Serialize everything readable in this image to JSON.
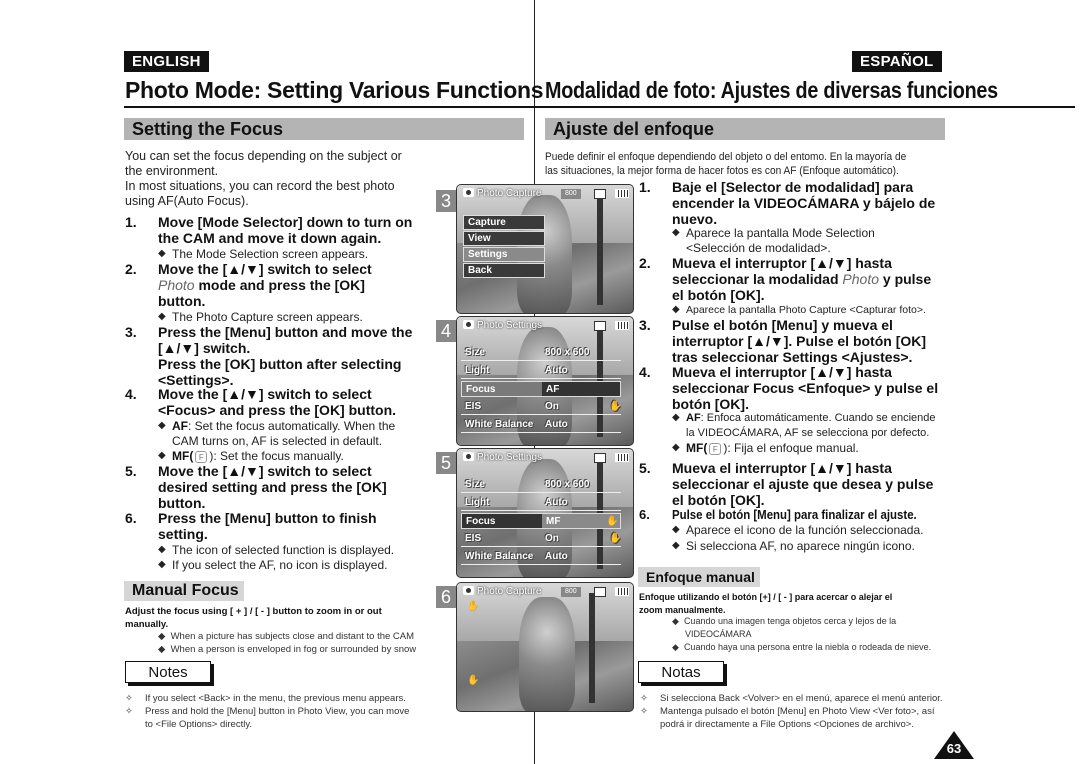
{
  "english": {
    "lang_label": "ENGLISH",
    "page_title": "Photo Mode: Setting Various Functions",
    "section_title": "Setting the Focus",
    "intro": [
      "You can set the focus depending on the subject or",
      "the environment.",
      "In most situations, you can record the best photo",
      "using AF(Auto Focus)."
    ],
    "steps": [
      {
        "num": "1.",
        "lines": [
          "Move [Mode Selector] down to turn on",
          "the CAM and move it down again."
        ]
      },
      {
        "num": "2.",
        "lines": [
          "Move the [▲/▼] switch to select",
          "mode and press the [OK]",
          "button."
        ],
        "italic_word": "Photo"
      },
      {
        "num": "3.",
        "lines": [
          "Press the [Menu] button and move the",
          "[▲/▼] switch.",
          "Press the [OK] button after selecting",
          "<Settings>."
        ]
      },
      {
        "num": "4.",
        "lines": [
          "Move the [▲/▼] switch to select",
          "<Focus> and press the [OK] button."
        ]
      },
      {
        "num": "5.",
        "lines": [
          "Move the [▲/▼] switch to select",
          "desired setting and press the [OK]",
          "button."
        ]
      },
      {
        "num": "6.",
        "lines": [
          "Press the [Menu] button to finish",
          "setting."
        ]
      }
    ],
    "bullets": {
      "step1": "The Mode Selection screen appears.",
      "step2": "The Photo Capture screen appears.",
      "step4_af_label": "AF",
      "step4_af_text": ": Set the focus automatically. When the",
      "step4_af_text2": "CAM turns on, AF is selected in default.",
      "step4_mf_label": "MF(",
      "step4_mf_text": "): Set the focus manually.",
      "step6_a": "The icon of selected function is displayed.",
      "step6_b": "If you select the AF, no icon is displayed."
    },
    "manual_focus": {
      "title": "Manual Focus",
      "desc_line1": "Adjust the focus using [ + ] / [ - ] button to zoom in or out",
      "desc_line2": "manually.",
      "bullets": [
        "When a picture has subjects close and distant to   the CAM",
        "When a person is enveloped in fog or surrounded by snow"
      ]
    },
    "notes": {
      "title": "Notes",
      "items": [
        "If you select <Back> in the menu, the previous menu appears.",
        "Press and hold the [Menu] button in Photo View, you can move",
        "to <File Options> directly."
      ]
    }
  },
  "spanish": {
    "lang_label": "ESPAÑOL",
    "page_title": "Modalidad de foto: Ajustes de diversas funciones",
    "section_title": "Ajuste del enfoque",
    "intro": [
      "Puede definir el enfoque dependiendo del objeto o del entomo. En la mayoría de",
      "las situaciones, la mejor forma de hacer fotos es con AF (Enfoque automático)."
    ],
    "steps": [
      {
        "num": "1.",
        "lines": [
          "Baje el [Selector de modalidad] para",
          "encender la VIDEOCÁMARA y bájelo de",
          "nuevo."
        ]
      },
      {
        "num": "2.",
        "lines": [
          "Mueva el interruptor [▲/▼] hasta",
          "seleccionar la modalidad",
          "y pulse",
          "el botón [OK]."
        ],
        "italic_word": "Photo"
      },
      {
        "num": "3.",
        "lines": [
          "Pulse el botón [Menu] y mueva el",
          "interruptor [▲/▼]. Pulse el botón [OK]",
          "tras seleccionar Settings <Ajustes>."
        ]
      },
      {
        "num": "4.",
        "lines": [
          "Mueva el interruptor [▲/▼] hasta",
          "seleccionar Focus <Enfoque> y pulse el",
          "botón [OK]."
        ]
      },
      {
        "num": "5.",
        "lines": [
          "Mueva el interruptor [▲/▼] hasta",
          "seleccionar el ajuste que desea y pulse",
          "el botón [OK]."
        ]
      },
      {
        "num": "6.",
        "lines": [
          "Pulse el botón [Menu] para finalizar el ajuste."
        ]
      }
    ],
    "bullets": {
      "step1_a": "Aparece la pantalla Mode Selection",
      "step1_b": "<Selección de modalidad>.",
      "step2": "Aparece la pantalla Photo Capture <Capturar foto>.",
      "step4_af_label": "AF",
      "step4_af_text": ": Enfoca automáticamente. Cuando se enciende",
      "step4_af_text2": "la VIDEOCÁMARA, AF se selecciona por defecto.",
      "step4_mf_label": "MF(",
      "step4_mf_text": "): Fija el enfoque manual.",
      "step6_a": "Aparece el icono de la función seleccionada.",
      "step6_b": "Si selecciona AF, no aparece ningún icono."
    },
    "manual_focus": {
      "title": "Enfoque manual",
      "desc_line1": "Enfoque utilizando el botón [+] / [ - ] para acercar o alejar el",
      "desc_line2": "zoom manualmente.",
      "bullets": [
        "Cuando una imagen tenga objetos cerca y lejos de la",
        "VIDEOCÁMARA",
        "Cuando haya una persona entre la niebla o rodeada de nieve."
      ]
    },
    "notes": {
      "title": "Notas",
      "items": [
        "Si selecciona Back <Volver> en el menú, aparece el menú anterior.",
        "Mantenga pulsado el botón [Menu] en Photo View <Ver foto>, así",
        "podrá ir directamente a File Options <Opciones de archivo>."
      ]
    }
  },
  "screens": [
    {
      "number": "3",
      "title": "Photo Capture",
      "resolution": "800",
      "menu": [
        "Capture",
        "View",
        "Settings",
        "Back"
      ],
      "selected": "Settings"
    },
    {
      "number": "4",
      "title": "Photo Settings",
      "rows": [
        {
          "label": "Size",
          "value": "800 x 600"
        },
        {
          "label": "Light",
          "value": "Auto"
        },
        {
          "label": "Focus",
          "value": "AF"
        },
        {
          "label": "EIS",
          "value": "On"
        },
        {
          "label": "White Balance",
          "value": "Auto"
        }
      ],
      "highlighted": "Focus"
    },
    {
      "number": "5",
      "title": "Photo Settings",
      "rows": [
        {
          "label": "Size",
          "value": "800 x 600"
        },
        {
          "label": "Light",
          "value": "Auto"
        },
        {
          "label": "Focus",
          "value": "MF"
        },
        {
          "label": "EIS",
          "value": "On"
        },
        {
          "label": "White Balance",
          "value": "Auto"
        }
      ],
      "highlighted": "Focus"
    },
    {
      "number": "6",
      "title": "Photo Capture",
      "resolution": "800"
    }
  ],
  "page_number": "63"
}
